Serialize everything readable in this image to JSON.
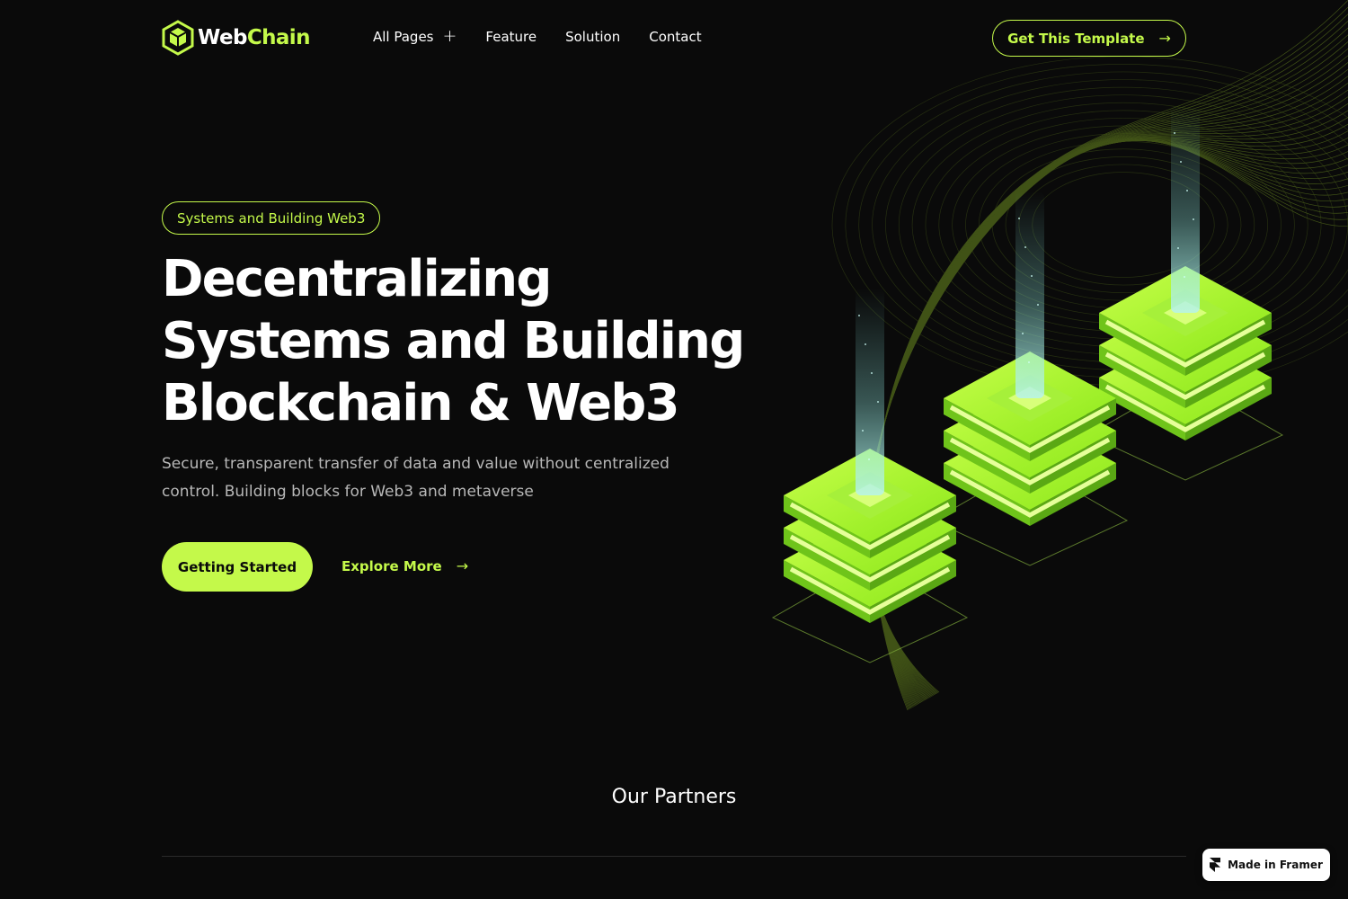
{
  "brand": {
    "name_part1": "Web",
    "name_part2": "Chain",
    "accent": "#c4f94a",
    "background": "#0a0a0a"
  },
  "nav": {
    "items": [
      {
        "label": "All Pages",
        "icon": "plus-icon"
      },
      {
        "label": "Feature"
      },
      {
        "label": "Solution"
      },
      {
        "label": "Contact"
      }
    ],
    "cta_label": "Get This Template",
    "cta_icon": "arrow-right-icon"
  },
  "hero": {
    "badge": "Systems and Building Web3",
    "title_lines": [
      "Decentralizing",
      "Systems and Building",
      "Blockchain & Web3"
    ],
    "subtitle": "Secure, transparent transfer of data and value without centralized control. Building blocks for Web3 and metaverse",
    "primary_button": "Getting Started",
    "secondary_button": "Explore More",
    "secondary_icon": "arrow-right-icon",
    "illustration": "isometric-blockchain-blocks"
  },
  "partners": {
    "title": "Our Partners"
  },
  "framer_badge": {
    "label": "Made in Framer",
    "icon": "framer-icon"
  }
}
